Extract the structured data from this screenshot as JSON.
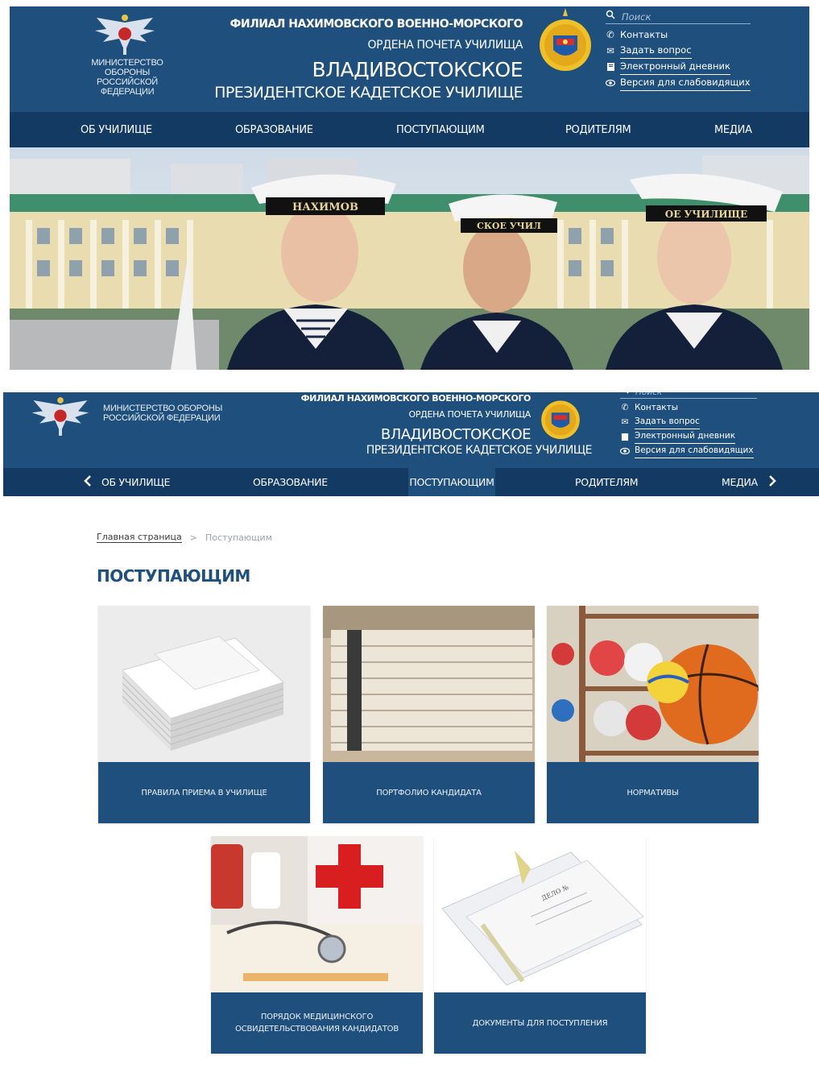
{
  "header": {
    "ministry_line1": "МИНИСТЕРСТВО ОБОРОНЫ",
    "ministry_line2": "РОССИЙСКОЙ ФЕДЕРАЦИИ",
    "title_line1": "ФИЛИАЛ НАХИМОВСКОГО ВОЕННО-МОРСКОГО",
    "title_line2": "ОРДЕНА ПОЧЕТА УЧИЛИЩА",
    "title_line3": "ВЛАДИВОСТОКСКОЕ",
    "title_line4": "ПРЕЗИДЕНТСКОЕ КАДЕТСКОЕ УЧИЛИЩЕ",
    "search_placeholder": "Поиск",
    "links": [
      "Контакты",
      "Задать вопрос",
      "Электронный дневник",
      "Версия для слабовидящих"
    ]
  },
  "nav": {
    "items": [
      "ОБ УЧИЛИЩЕ",
      "ОБРАЗОВАНИЕ",
      "ПОСТУПАЮЩИМ",
      "РОДИТЕЛЯМ",
      "МЕДИА"
    ],
    "active": "ПОСТУПАЮЩИМ"
  },
  "hero": {
    "cap_ribbon_1": "НАХИМОВ",
    "cap_ribbon_2": "СКОЕ УЧИЛ",
    "cap_ribbon_3": "ОЕ УЧИЛИЩЕ"
  },
  "breadcrumb": {
    "home": "Главная страница",
    "separator": ">",
    "current": "Поступающим"
  },
  "page": {
    "title": "ПОСТУПАЮЩИМ"
  },
  "cards": [
    {
      "label": "ПРАВИЛА ПРИЕМА В УЧИЛИЩЕ"
    },
    {
      "label": "ПОРТФОЛИО КАНДИДАТА"
    },
    {
      "label": "НОРМАТИВЫ"
    },
    {
      "label": "ПОРЯДОК МЕДИЦИНСКОГО ОСВИДЕТЕЛЬСТВОВАНИЯ КАНДИДАТОВ"
    },
    {
      "label": "ДОКУМЕНТЫ ДЛЯ ПОСТУПЛЕНИЯ"
    }
  ],
  "misc": {
    "folder_label": "ДЕЛО №"
  },
  "colors": {
    "header_blue": "#1f4f7c",
    "nav_blue": "#123a63",
    "active_tab": "#1f4f7c",
    "card_blue": "#1f4f7c"
  }
}
